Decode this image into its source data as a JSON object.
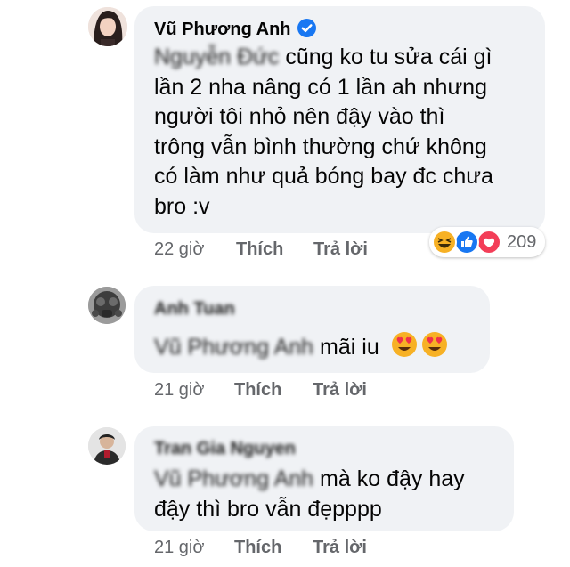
{
  "comments": [
    {
      "author": "Vũ Phương Anh",
      "verified": true,
      "lines": [
        {
          "mention": "Nguyễn Đức",
          "text": " cũng ko tu sửa cái gì"
        },
        {
          "text": "lần 2 nha nâng có 1 lần ah nhưng"
        },
        {
          "text": "người tôi nhỏ nên đậy vào thì"
        },
        {
          "text": "trông vẫn bình thường chứ không"
        },
        {
          "text": "có làm như quả bóng bay đc chưa"
        },
        {
          "text": "bro :v"
        }
      ],
      "time": "22 giờ",
      "like_label": "Thích",
      "reply_label": "Trả lời",
      "reactions": {
        "icons": [
          "haha-icon",
          "like-icon",
          "love-icon"
        ],
        "count": "209"
      }
    },
    {
      "author": "Anh Tuan",
      "verified": false,
      "lines": [
        {
          "mention": "Vũ Phương Anh",
          "text": " mãi iu"
        }
      ],
      "emoji": [
        "heart-eyes-icon",
        "heart-eyes-icon"
      ],
      "time": "21 giờ",
      "like_label": "Thích",
      "reply_label": "Trả lời"
    },
    {
      "author": "Tran Gia Nguyen",
      "verified": false,
      "lines": [
        {
          "mention": "Vũ Phương Anh",
          "text": " mà ko đậy hay"
        },
        {
          "text": "đậy thì bro vẫn đẹpppp"
        }
      ],
      "time": "21 giờ",
      "like_label": "Thích",
      "reply_label": "Trả lời"
    }
  ],
  "colors": {
    "bubble": "#f0f2f5",
    "meta_text": "#65676b",
    "verified_badge": "#1877f2",
    "haha": "#f7b125",
    "like": "#1877f2",
    "love": "#f33e58"
  }
}
